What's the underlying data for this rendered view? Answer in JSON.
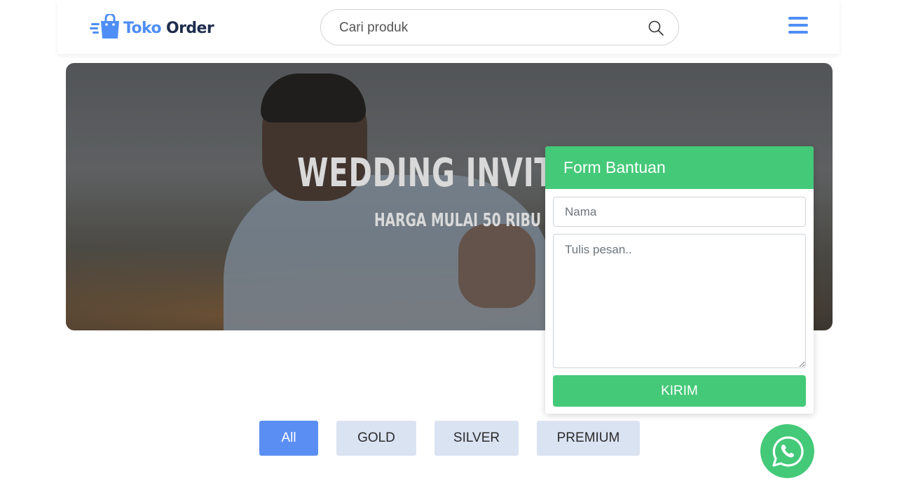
{
  "header": {
    "logo": {
      "text_part1": "Toko",
      "text_part2": "Order",
      "icon": "shopping-bag-icon"
    },
    "search": {
      "placeholder": "Cari produk",
      "icon": "search-icon"
    },
    "menu_icon": "hamburger-menu-icon"
  },
  "banner": {
    "title": "WEDDING INVITAT",
    "subtitle": "HARGA MULAI 50 RIBU"
  },
  "help_form": {
    "title": "Form Bantuan",
    "name_placeholder": "Nama",
    "message_placeholder": "Tulis pesan..",
    "submit_label": "KIRIM"
  },
  "filters": {
    "items": [
      {
        "label": "All",
        "active": true
      },
      {
        "label": "GOLD",
        "active": false
      },
      {
        "label": "SILVER",
        "active": false
      },
      {
        "label": "PREMIUM",
        "active": false
      }
    ]
  },
  "whatsapp": {
    "icon": "whatsapp-icon"
  },
  "colors": {
    "brand_blue": "#4f8ef7",
    "brand_dark": "#1f2d4e",
    "green": "#44c978",
    "filter_active": "#5b8ef2",
    "filter_inactive": "#dae3f2"
  }
}
